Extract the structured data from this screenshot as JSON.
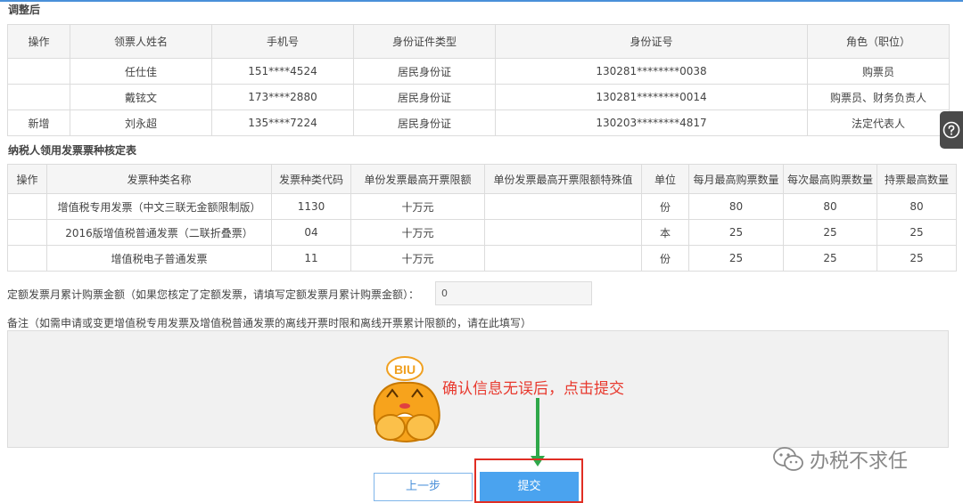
{
  "section1": {
    "title": "调整后",
    "headers": [
      "操作",
      "领票人姓名",
      "手机号",
      "身份证件类型",
      "身份证号",
      "角色（职位）"
    ],
    "rows": [
      [
        "",
        "任仕佳",
        "151****4524",
        "居民身份证",
        "130281********0038",
        "购票员"
      ],
      [
        "",
        "戴铉文",
        "173****2880",
        "居民身份证",
        "130281********0014",
        "购票员、财务负责人"
      ],
      [
        "新增",
        "刘永超",
        "135****7224",
        "居民身份证",
        "130203********4817",
        "法定代表人"
      ]
    ]
  },
  "section2": {
    "title": "纳税人领用发票票种核定表",
    "headers": [
      "操作",
      "发票种类名称",
      "发票种类代码",
      "单份发票最高开票限额",
      "单份发票最高开票限额特殊值",
      "单位",
      "每月最高购票数量",
      "每次最高购票数量",
      "持票最高数量"
    ],
    "rows": [
      [
        "",
        "增值税专用发票（中文三联无金额限制版）",
        "1130",
        "十万元",
        "",
        "份",
        "80",
        "80",
        "80"
      ],
      [
        "",
        "2016版增值税普通发票（二联折叠票）",
        "04",
        "十万元",
        "",
        "本",
        "25",
        "25",
        "25"
      ],
      [
        "",
        "增值税电子普通发票",
        "11",
        "十万元",
        "",
        "份",
        "25",
        "25",
        "25"
      ]
    ]
  },
  "amount": {
    "label": "定额发票月累计购票金额（如果您核定了定额发票，请填写定额发票月累计购票金额）：",
    "value": "0"
  },
  "remarks": {
    "label": "备注（如需申请或变更增值税专用发票及增值税普通发票的离线开票时限和离线开票累计限额的，请在此填写）"
  },
  "annotation": {
    "text": "确认信息无误后，点击提交",
    "mascot_text": "BIU"
  },
  "buttons": {
    "prev": "上一步",
    "submit": "提交"
  },
  "help": {
    "icon": "question-icon"
  },
  "watermark": {
    "text": "办税不求任",
    "icon": "wechat-icon"
  },
  "colors": {
    "accent": "#4a90d9",
    "submit": "#4aa3ef",
    "annotation": "#e8392e",
    "arrow": "#2fa84a",
    "highlight": "#e02e24"
  }
}
